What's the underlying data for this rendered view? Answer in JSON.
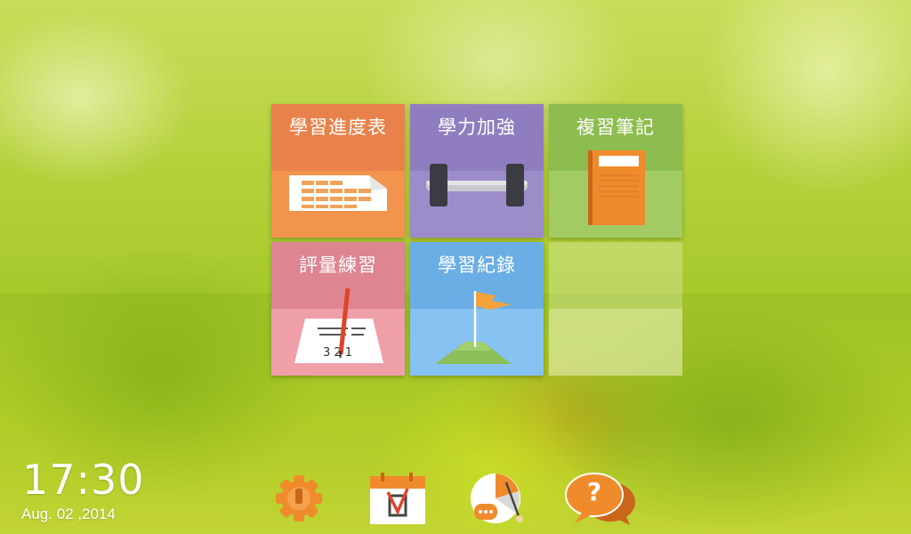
{
  "tiles": [
    {
      "id": "progress-table",
      "label": "學習進度表",
      "top_color": "#e8824a",
      "bottom_color": "#f2934e"
    },
    {
      "id": "strengthen",
      "label": "學力加強",
      "top_color": "#8f7dc0",
      "bottom_color": "#9d8cca"
    },
    {
      "id": "review-notes",
      "label": "複習筆記",
      "top_color": "#8dbd4e",
      "bottom_color": "#a2cb64"
    },
    {
      "id": "assessment",
      "label": "評量練習",
      "top_color": "#dd8591",
      "bottom_color": "#ee9fa8"
    },
    {
      "id": "learning-record",
      "label": "學習紀錄",
      "top_color": "#6aaee5",
      "bottom_color": "#86c3f2"
    }
  ],
  "status": {
    "time": "17:30",
    "date": "Aug. 02 ,2014"
  },
  "dock": {
    "settings_icon": "gear-icon",
    "calendar_icon": "calendar-check-icon",
    "stats_icon": "pie-chart-pointer-icon",
    "help_icon": "help-question-bubble-icon",
    "help_symbol": "?"
  }
}
